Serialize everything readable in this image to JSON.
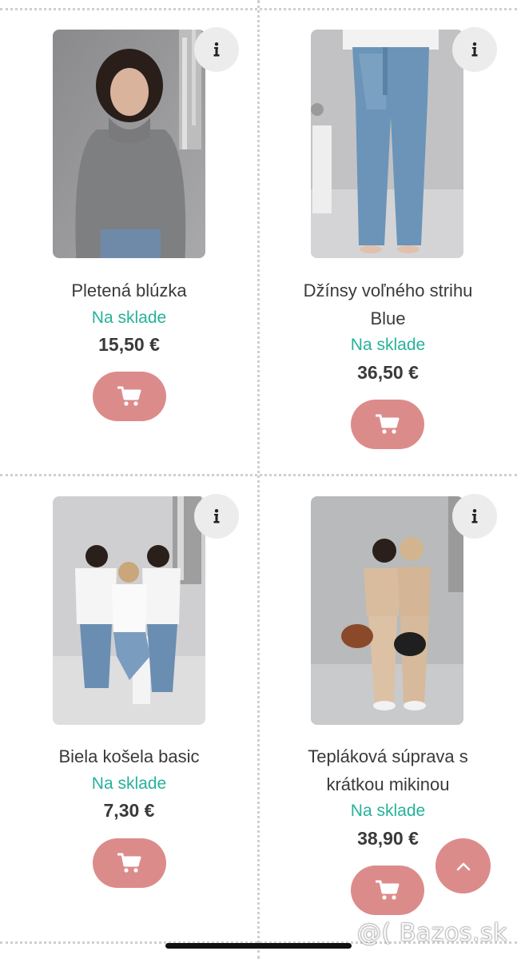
{
  "products": [
    {
      "title": "Pletená blúzka",
      "stock": "Na sklade",
      "price": "15,50 €",
      "icon": "cart-icon"
    },
    {
      "title_line1": "Džínsy voľného strihu",
      "title_line2": "Blue",
      "stock": "Na sklade",
      "price": "36,50 €",
      "icon": "cart-icon"
    },
    {
      "title": "Biela košela basic",
      "stock": "Na sklade",
      "price": "7,30 €",
      "icon": "cart-icon"
    },
    {
      "title_line1": "Tepláková súprava s",
      "title_line2": "krátkou mikinou",
      "stock": "Na sklade",
      "price": "38,90 €",
      "icon": "cart-icon"
    }
  ],
  "info_icon": "info-icon",
  "scroll_top_icon": "chevron-up-icon",
  "watermark": "@( Bazos.sk",
  "colors": {
    "accent": "#dc8b8b",
    "stock": "#27b19a",
    "text": "#3a3a3a",
    "info_bg": "#ececec"
  }
}
